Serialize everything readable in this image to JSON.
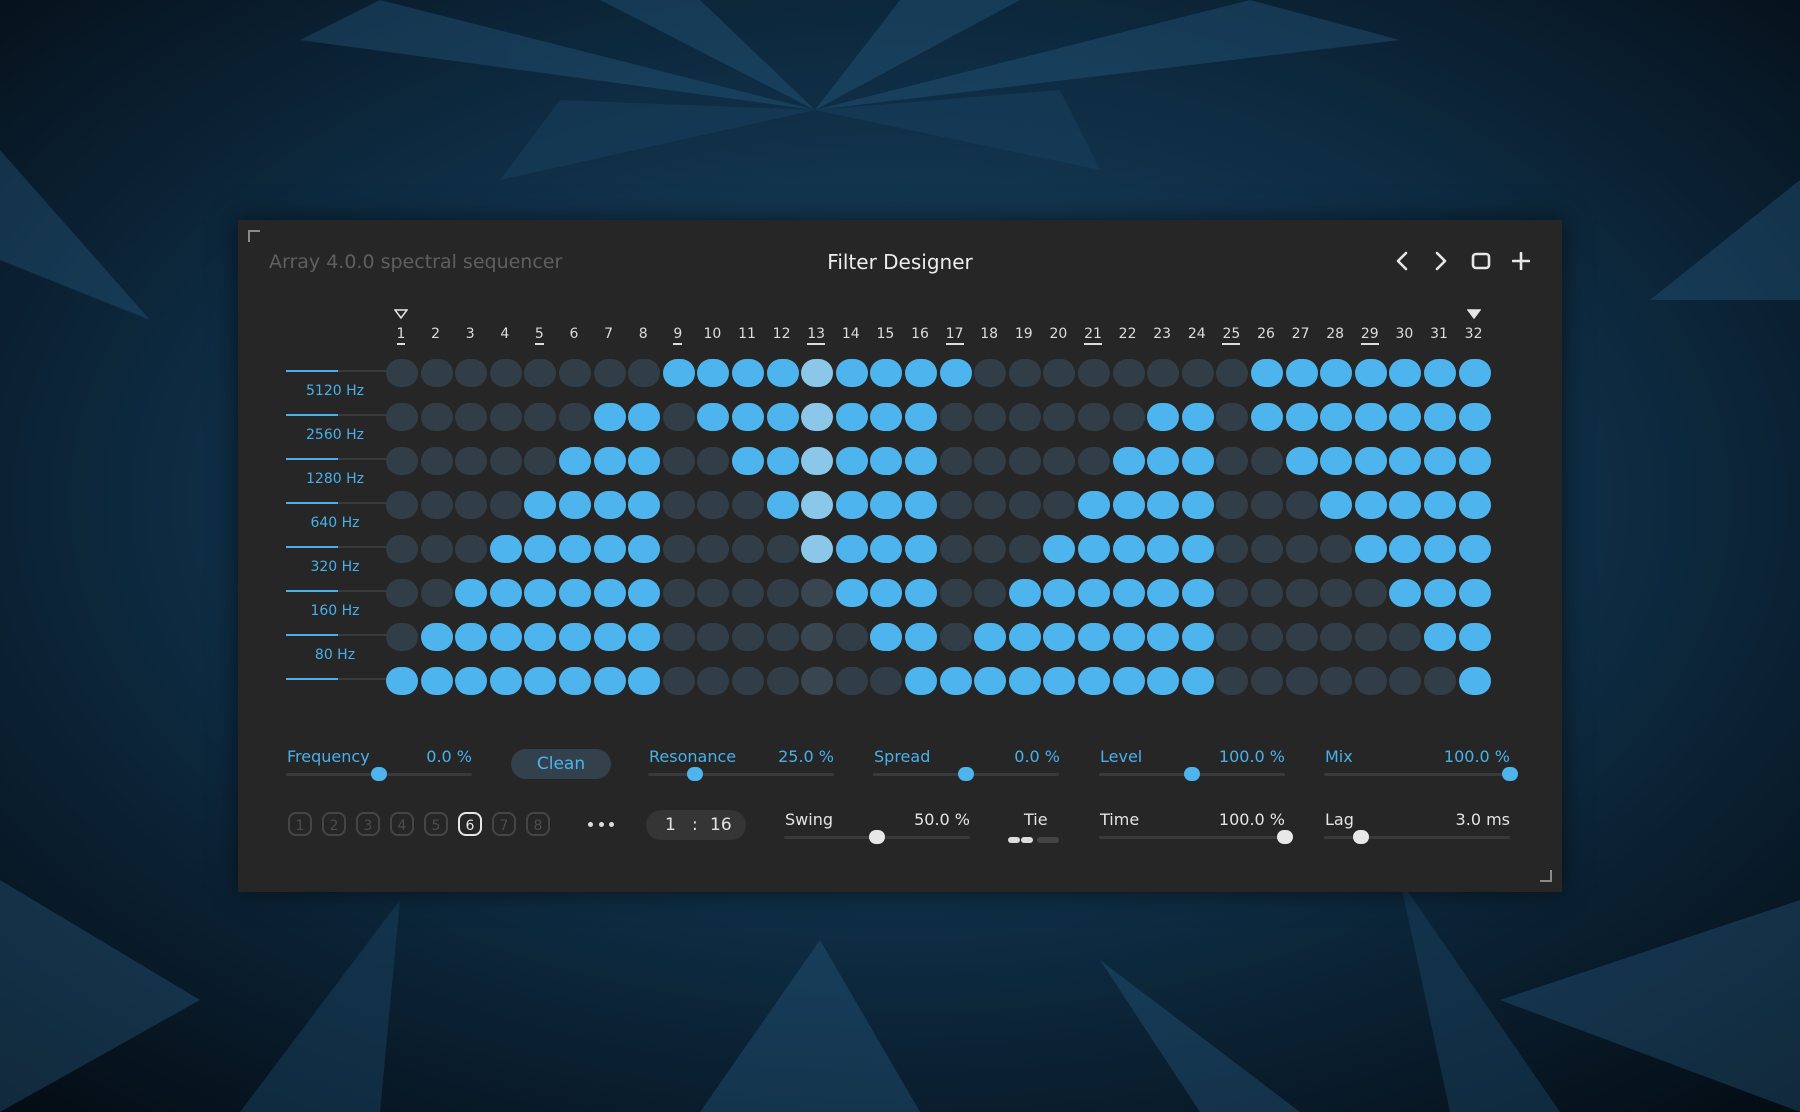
{
  "window": {
    "app_title": "Array 4.0.0 spectral sequencer",
    "page_title": "Filter Designer",
    "buttons": [
      "previous-icon",
      "next-icon",
      "window-icon",
      "add-icon"
    ]
  },
  "steps": {
    "numbers": [
      "1",
      "2",
      "3",
      "4",
      "5",
      "6",
      "7",
      "8",
      "9",
      "10",
      "11",
      "12",
      "13",
      "14",
      "15",
      "16",
      "17",
      "18",
      "19",
      "20",
      "21",
      "22",
      "23",
      "24",
      "25",
      "26",
      "27",
      "28",
      "29",
      "30",
      "31",
      "32"
    ],
    "loop_start": 1,
    "loop_end": 32,
    "current_step": 13
  },
  "bands": {
    "labels": [
      "5120 Hz",
      "2560 Hz",
      "1280 Hz",
      "640 Hz",
      "320 Hz",
      "160 Hz",
      "80 Hz"
    ]
  },
  "grid": [
    "00000000111111111000000001111111",
    "00000011011111110000001101111111",
    "00000111001111110000011100111111",
    "00001111000111110000111100011111",
    "00011111000011110001111100001111",
    "00111111000001110011111100000111",
    "01111111000000110111111100000011",
    "11111111000000011111111100000001"
  ],
  "controls": {
    "frequency": {
      "label": "Frequency",
      "value": "0.0 %",
      "fraction": 0.5
    },
    "clean_label": "Clean",
    "resonance": {
      "label": "Resonance",
      "value": "25.0 %",
      "fraction": 0.25
    },
    "spread": {
      "label": "Spread",
      "value": "0.0 %",
      "fraction": 0.5
    },
    "level": {
      "label": "Level",
      "value": "100.0 %",
      "fraction": 0.5
    },
    "mix": {
      "label": "Mix",
      "value": "100.0 %",
      "fraction": 1.0
    },
    "patterns": [
      "1",
      "2",
      "3",
      "4",
      "5",
      "6",
      "7",
      "8"
    ],
    "active_pattern": 6,
    "rate": {
      "numerator": "1",
      "separator": ":",
      "denominator": "16"
    },
    "swing": {
      "label": "Swing",
      "value": "50.0 %",
      "fraction": 0.5
    },
    "tie": {
      "label": "Tie"
    },
    "time": {
      "label": "Time",
      "value": "100.0 %",
      "fraction": 1.0
    },
    "lag": {
      "label": "Lag",
      "value": "3.0 ms",
      "fraction": 0.2
    }
  },
  "colors": {
    "accent": "#4db4ee",
    "cell_off": "#313d47",
    "cell_highlight": "#8ac7e8",
    "panel": "#262626"
  }
}
